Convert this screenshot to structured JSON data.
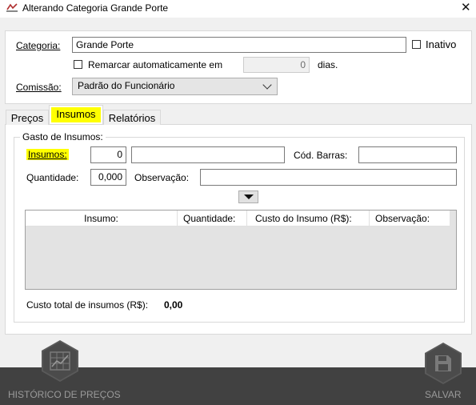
{
  "window": {
    "title": "Alterando Categoria Grande Porte",
    "close_glyph": "✕",
    "app_icon": "app-logo-icon"
  },
  "header": {
    "categoria_label": "Categoria:",
    "categoria_value": "Grande Porte",
    "inativo_label": "Inativo",
    "inativo_checked": false,
    "remarcar_label": "Remarcar automaticamente em",
    "remarcar_checked": false,
    "dias_value": "0",
    "dias_label": "dias.",
    "comissao_label": "Comissão:",
    "comissao_value": "Padrão do Funcionário"
  },
  "tabs": [
    {
      "label": "Preços",
      "active": false
    },
    {
      "label": "Insumos",
      "active": true
    },
    {
      "label": "Relatórios",
      "active": false
    }
  ],
  "insumos": {
    "group_title": "Gasto de Insumos:",
    "insumos_label": "Insumos:",
    "insumo_code": "0",
    "insumo_name": "",
    "cod_barras_label": "Cód. Barras:",
    "cod_barras_value": "",
    "quantidade_label": "Quantidade:",
    "quantidade_value": "0,000",
    "observacao_label": "Observação:",
    "observacao_value": "",
    "columns": [
      "Insumo:",
      "Quantidade:",
      "Custo do Insumo (R$):",
      "Observação:"
    ],
    "rows": [],
    "total_label": "Custo total de insumos (R$):",
    "total_value": "0,00"
  },
  "footer": {
    "historico_label": "HISTÓRICO DE PREÇOS",
    "salvar_label": "SALVAR"
  },
  "colors": {
    "highlight": "#ffff00",
    "footer_bg": "#414141"
  }
}
